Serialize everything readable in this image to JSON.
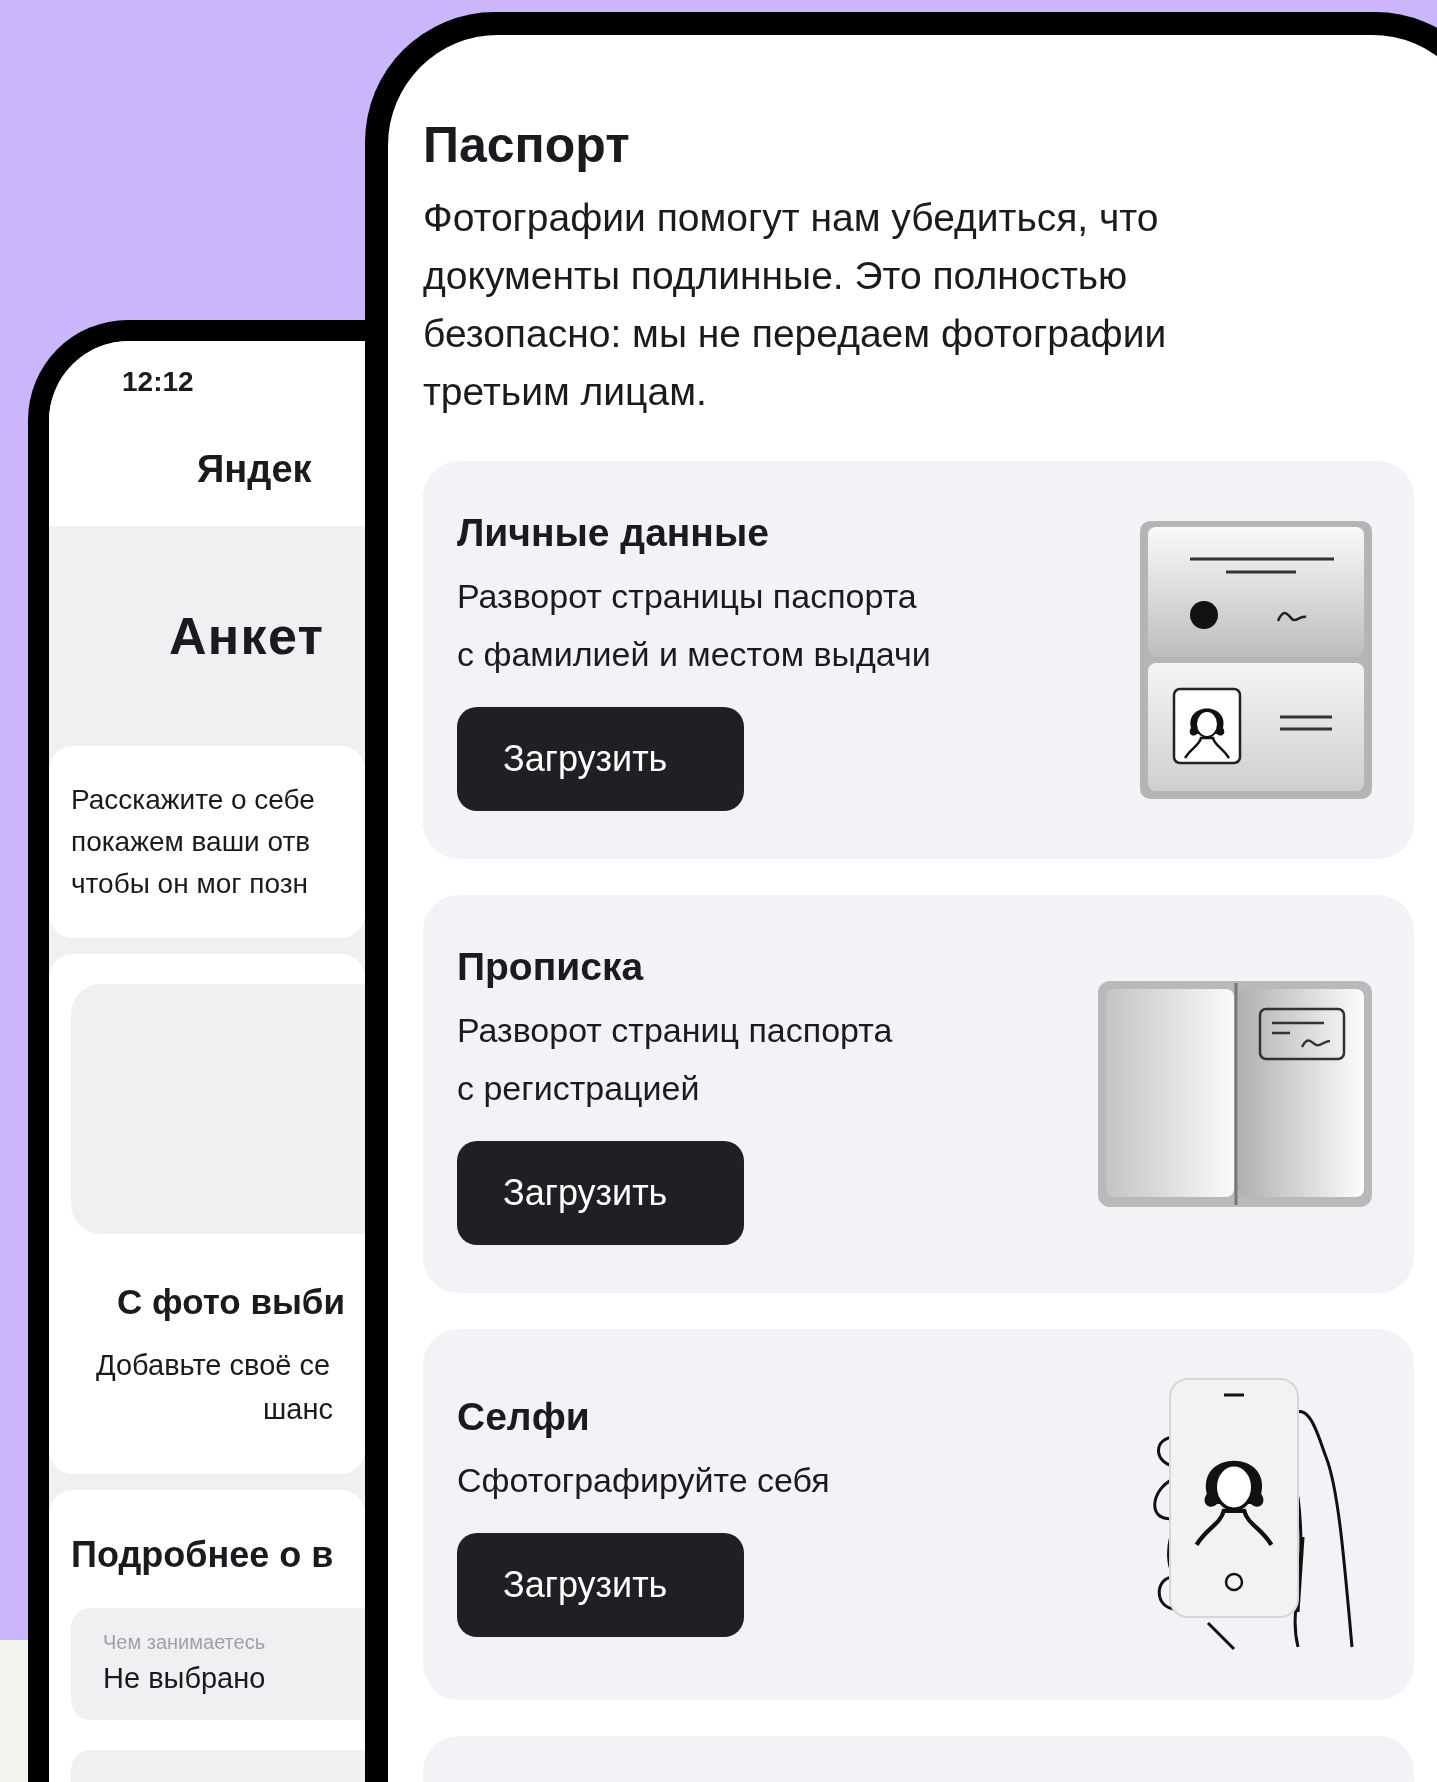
{
  "back_phone": {
    "status_time": "12:12",
    "app_title": "Яндек",
    "heading": "Анкет",
    "intro_lines": [
      "Расскажите о себе",
      "покажем ваши отв",
      "чтобы он мог позн"
    ],
    "photo_title": "С фото выби",
    "photo_lines": [
      "Добавьте своё се",
      "шанс"
    ],
    "details_title": "Подробнее о в",
    "field": {
      "label": "Чем занимаетесь",
      "value": "Не выбрано"
    }
  },
  "front_phone": {
    "title": "Паспорт",
    "description_lines": [
      "Фотографии помогут нам убедиться, что",
      "документы подлинные. Это полностью",
      "безопасно: мы не передаем фотографии",
      "третьим лицам."
    ],
    "cards": [
      {
        "kind": "personal",
        "title": "Личные данные",
        "lines": [
          "Разворот страницы паспорта",
          "с фамилией и местом выдачи"
        ],
        "button": "Загрузить"
      },
      {
        "kind": "registration",
        "title": "Прописка",
        "lines": [
          "Разворот страниц паспорта",
          "с регистрацией"
        ],
        "button": "Загрузить"
      },
      {
        "kind": "selfie",
        "title": "Селфи",
        "lines": [
          "Сфотографируйте себя"
        ],
        "button": "Загрузить"
      }
    ]
  }
}
